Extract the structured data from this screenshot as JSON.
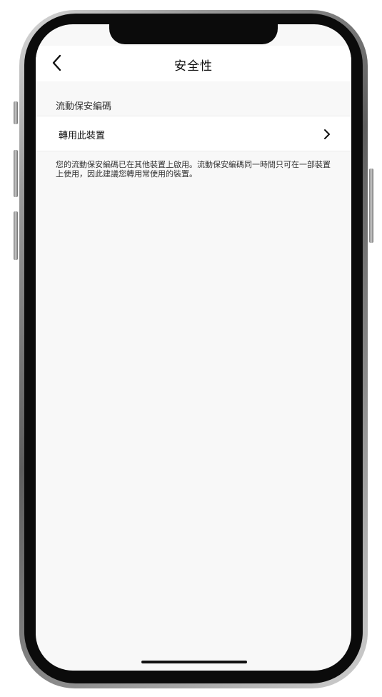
{
  "nav": {
    "back_icon": "chevron-left-icon",
    "title": "安全性"
  },
  "section": {
    "header": "流動保安編碼"
  },
  "row": {
    "label": "轉用此裝置",
    "chevron_icon": "chevron-right-icon"
  },
  "footnote": {
    "text": "您的流動保安編碼已在其他裝置上啟用。流動保安編碼同一時間只可在一部裝置上使用，因此建議您轉用常使用的裝置。"
  },
  "colors": {
    "background": "#f8f8f8",
    "surface": "#ffffff",
    "text_primary": "#111111",
    "text_secondary": "#333333"
  }
}
